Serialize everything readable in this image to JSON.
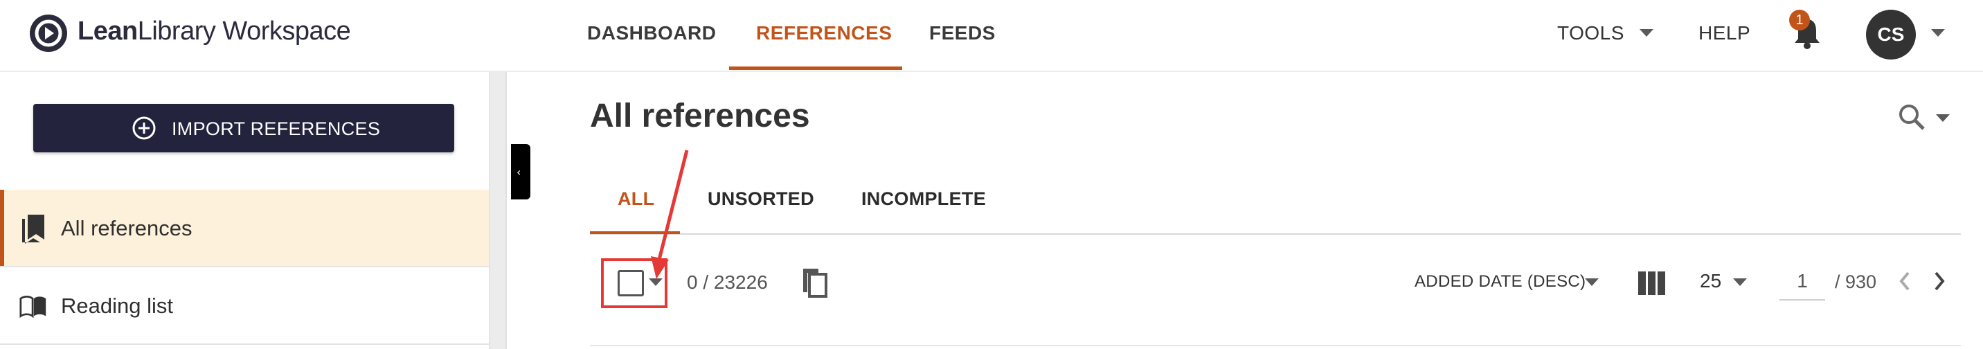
{
  "header": {
    "logo": {
      "brand_bold": "Lean",
      "brand_rest": "Library Workspace"
    },
    "nav": [
      {
        "label": "DASHBOARD"
      },
      {
        "label": "REFERENCES",
        "active": true
      },
      {
        "label": "FEEDS"
      }
    ],
    "tools_label": "TOOLS",
    "help_label": "HELP",
    "notifications_count": "1",
    "user_initials": "CS"
  },
  "sidebar": {
    "import_button": "IMPORT REFERENCES",
    "items": [
      {
        "label": "All references",
        "icon": "bookmarks-icon",
        "active": true
      },
      {
        "label": "Reading list",
        "icon": "open-book-icon"
      }
    ]
  },
  "main": {
    "title": "All references",
    "tabs": [
      {
        "label": "ALL",
        "active": true
      },
      {
        "label": "UNSORTED"
      },
      {
        "label": "INCOMPLETE"
      }
    ],
    "toolbar": {
      "selection_count": "0 / 23226",
      "sort_label": "ADDED DATE (DESC)",
      "per_page": "25",
      "current_page": "1",
      "total_pages": "/ 930"
    }
  },
  "colors": {
    "accent": "#c2541a",
    "primary_dark": "#24233e",
    "active_bg": "#fdf1dc",
    "annotation": "#e53935"
  }
}
